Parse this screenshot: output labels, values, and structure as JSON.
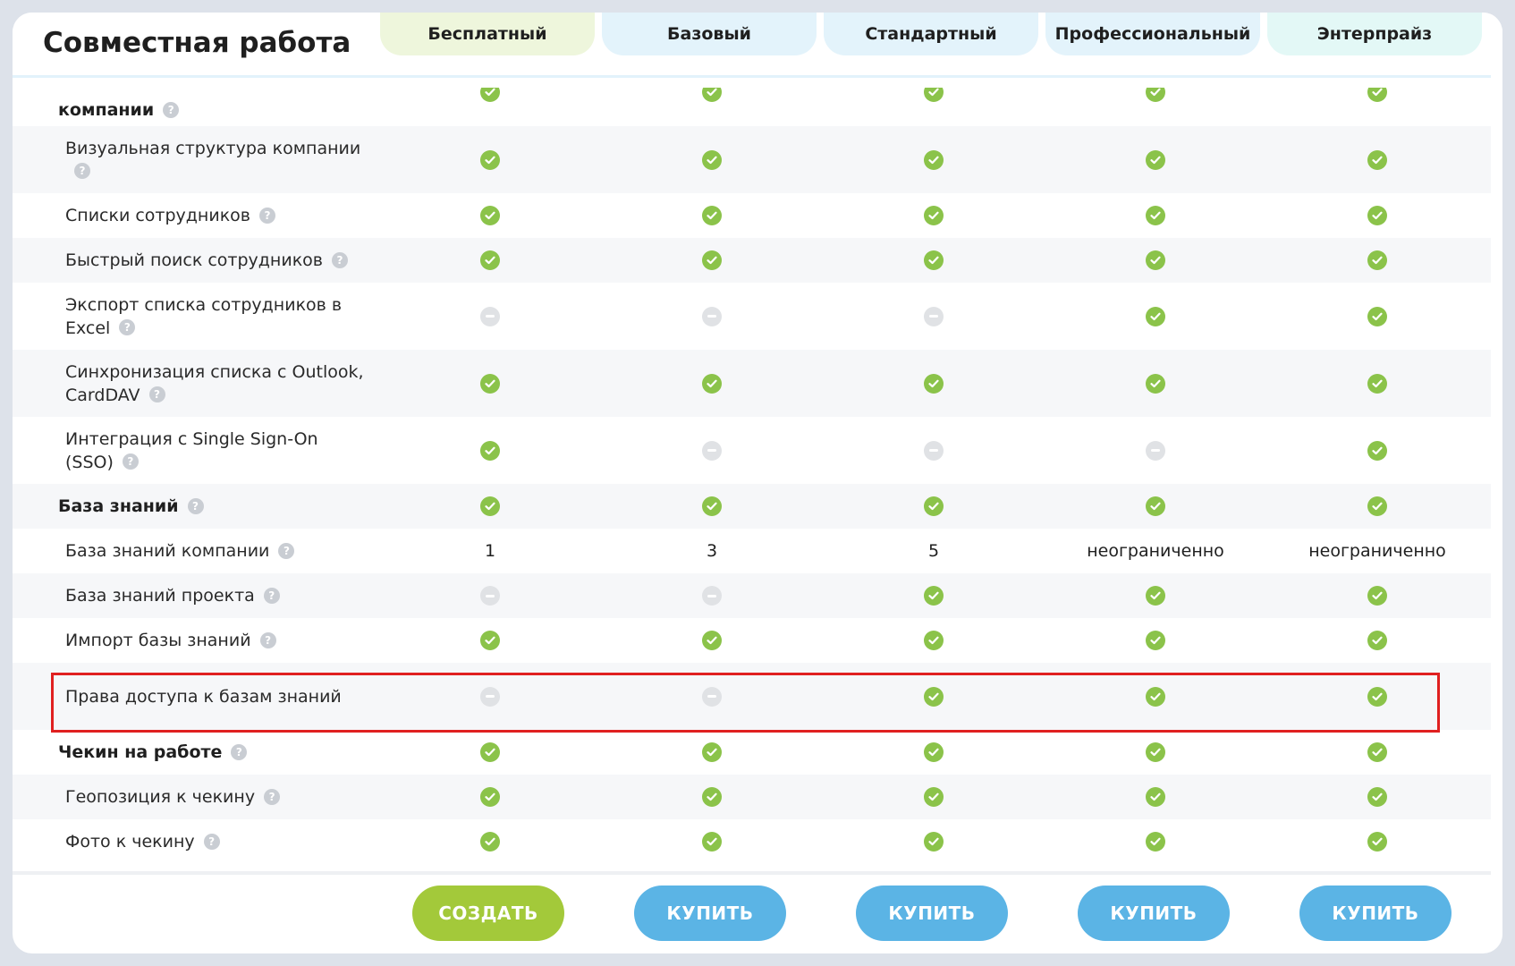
{
  "title": "Совместная работа",
  "plans": [
    {
      "name": "Бесплатный",
      "color": "#eef6dc"
    },
    {
      "name": "Базовый",
      "color": "#e3f3fb"
    },
    {
      "name": "Стандартный",
      "color": "#e3f3fb"
    },
    {
      "name": "Профессиональный",
      "color": "#e3f3fb"
    },
    {
      "name": "Энтерпрайз",
      "color": "#e3f8f6"
    }
  ],
  "rows": [
    {
      "label": "компании",
      "type": "section-cut",
      "values": [
        "check",
        "check",
        "check",
        "check",
        "check"
      ]
    },
    {
      "label": "Визуальная структура компании",
      "type": "sub",
      "values": [
        "check",
        "check",
        "check",
        "check",
        "check"
      ]
    },
    {
      "label": "Списки сотрудников",
      "type": "sub",
      "values": [
        "check",
        "check",
        "check",
        "check",
        "check"
      ]
    },
    {
      "label": "Быстрый поиск сотрудников",
      "type": "sub",
      "values": [
        "check",
        "check",
        "check",
        "check",
        "check"
      ]
    },
    {
      "label": "Экспорт списка сотрудников в Excel",
      "type": "sub",
      "values": [
        "dash",
        "dash",
        "dash",
        "check",
        "check"
      ]
    },
    {
      "label": "Синхронизация списка с Outlook, CardDAV",
      "type": "sub",
      "values": [
        "check",
        "check",
        "check",
        "check",
        "check"
      ]
    },
    {
      "label": "Интеграция с Single Sign-On (SSO)",
      "type": "sub",
      "values": [
        "check",
        "dash",
        "dash",
        "dash",
        "check"
      ]
    },
    {
      "label": "База знаний",
      "type": "section",
      "values": [
        "check",
        "check",
        "check",
        "check",
        "check"
      ]
    },
    {
      "label": "База знаний компании",
      "type": "sub",
      "values": [
        "1",
        "3",
        "5",
        "неограниченно",
        "неограниченно"
      ]
    },
    {
      "label": "База знаний проекта",
      "type": "sub",
      "values": [
        "dash",
        "dash",
        "check",
        "check",
        "check"
      ]
    },
    {
      "label": "Импорт базы знаний",
      "type": "sub",
      "values": [
        "check",
        "check",
        "check",
        "check",
        "check"
      ]
    },
    {
      "label": "Права доступа к базам знаний",
      "type": "sub",
      "values": [
        "dash",
        "dash",
        "check",
        "check",
        "check"
      ]
    },
    {
      "label": "Чекин на работе",
      "type": "section",
      "values": [
        "check",
        "check",
        "check",
        "check",
        "check"
      ]
    },
    {
      "label": "Геопозиция к чекину",
      "type": "sub",
      "values": [
        "check",
        "check",
        "check",
        "check",
        "check"
      ]
    },
    {
      "label": "Фото к чекину",
      "type": "sub",
      "values": [
        "check",
        "check",
        "check",
        "check",
        "check"
      ]
    }
  ],
  "buttons": [
    {
      "label": "СОЗДАТЬ",
      "color": "#a3c93a"
    },
    {
      "label": "КУПИТЬ",
      "color": "#5bb4e5"
    },
    {
      "label": "КУПИТЬ",
      "color": "#5bb4e5"
    },
    {
      "label": "КУПИТЬ",
      "color": "#5bb4e5"
    },
    {
      "label": "КУПИТЬ",
      "color": "#5bb4e5"
    }
  ],
  "colors": {
    "check": "#8bc34a",
    "dash": "#e0e2e5",
    "highlight": "#e02020"
  }
}
